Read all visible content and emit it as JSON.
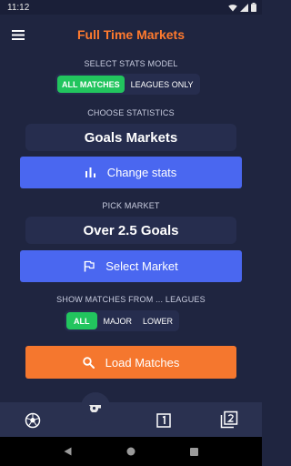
{
  "status_bar": {
    "time": "11:12"
  },
  "app_bar": {
    "title": "Full Time Markets"
  },
  "stats_model": {
    "label": "SELECT STATS MODEL",
    "options": [
      "ALL MATCHES",
      "LEAGUES ONLY"
    ],
    "selected": "ALL MATCHES"
  },
  "statistics": {
    "label": "CHOOSE STATISTICS",
    "value": "Goals Markets",
    "button_label": "Change stats"
  },
  "market": {
    "label": "PICK MARKET",
    "value": "Over 2.5 Goals",
    "button_label": "Select Market"
  },
  "leagues": {
    "label": "SHOW MATCHES FROM ... LEAGUES",
    "options": [
      "ALL",
      "MAJOR",
      "LOWER"
    ],
    "selected": "ALL"
  },
  "load_button": {
    "label": "Load Matches"
  },
  "bottom_nav": {
    "items": [
      "football-icon",
      "whistle-icon",
      "filter-1-icon",
      "filter-2-icon"
    ]
  },
  "colors": {
    "background": "#1f2540",
    "accent_orange": "#f5772e",
    "accent_blue": "#4a67f0",
    "accent_green": "#22c55e"
  }
}
